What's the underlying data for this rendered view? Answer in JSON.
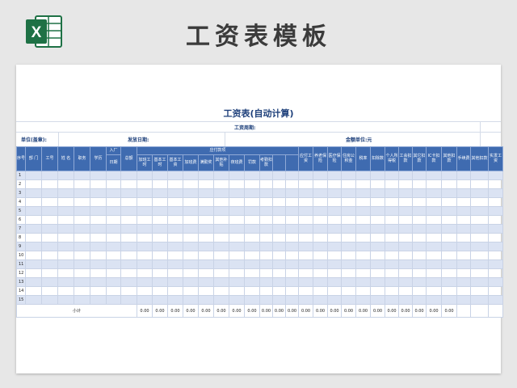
{
  "banner": {
    "title": "工资表模板"
  },
  "logo": {
    "icon": "excel-icon",
    "letter": "X",
    "color": "#1e7145"
  },
  "sheet": {
    "title": "工资表(自动计算)",
    "period_label": "工资周期:",
    "unit_label": "单位(盖章):",
    "issue_date_label": "发放日期:",
    "amount_unit_label": "金额单位:元"
  },
  "header": {
    "seq": "序号",
    "dept": "部 门",
    "emp_no": "工号",
    "name": "姓 名",
    "position": "职务",
    "education": "学历",
    "join_date_top": "入厂",
    "join_date_bottom": "日期",
    "total": "总额",
    "payable_group": "应付款项",
    "overtime_hours": "加班工时",
    "base_hours": "基本工时",
    "base_salary": "基本工资",
    "overtime_pay": "加班费",
    "full_attendance": "满勤奖",
    "other_allowance": "其他补贴",
    "shift_bonus": "夜班费",
    "fine": "罚款",
    "attendance_deduction": "考勤扣款",
    "payable_wage": "应付工资",
    "pension": "养老保险",
    "medical": "医疗保险",
    "housing_fund": "住房公积金",
    "taxable": "税率",
    "tax_deduction": "扣除数",
    "income_tax": "个人所得税",
    "union_fee": "工会扣款",
    "other_deduction": "其它扣款",
    "ic_card": "IC卡扣款",
    "other2": "其他扣款",
    "handling_fee": "手续费",
    "other3": "其他扣款",
    "net_pay": "实发工资",
    "remark": "备注",
    "account": "帐号",
    "signature": "签名"
  },
  "rows": [
    "1",
    "2",
    "3",
    "4",
    "5",
    "6",
    "7",
    "8",
    "9",
    "10",
    "11",
    "12",
    "13",
    "14",
    "15"
  ],
  "subtotal": {
    "label": "小计",
    "values": [
      "0.00",
      "0.00",
      "0.00",
      "0.00",
      "0.00",
      "0.00",
      "0.00",
      "0.00",
      "0.00",
      "0.00",
      "0.00",
      "0.00",
      "0.00",
      "0.00",
      "0.00",
      "0.00",
      "0.00",
      "0.00",
      "0.00",
      "0.00",
      "0.00",
      "0.00"
    ]
  },
  "colors": {
    "header_bg": "#3f6bb0",
    "alt_row": "#dbe3f3",
    "title": "#1d3f7a"
  }
}
